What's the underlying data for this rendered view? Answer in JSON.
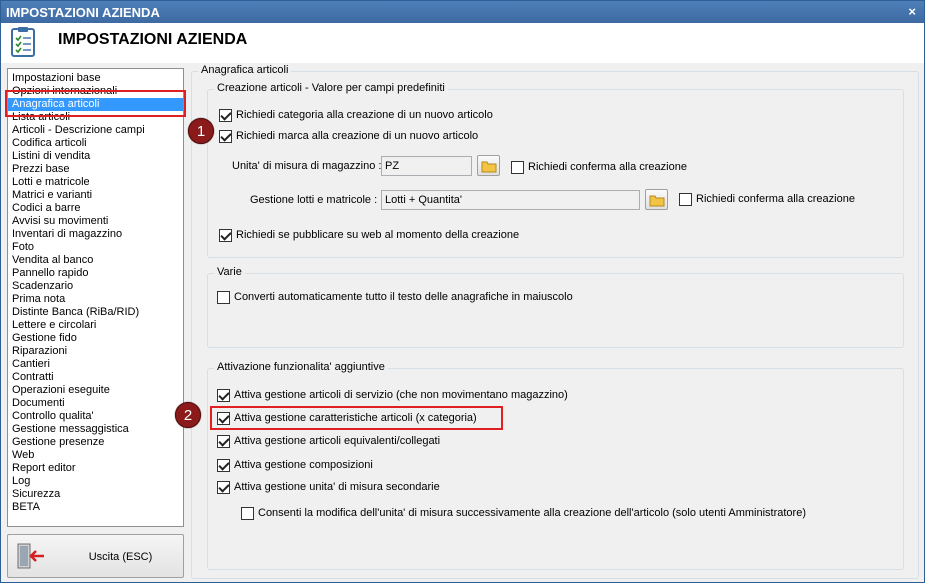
{
  "window": {
    "title": "IMPOSTAZIONI AZIENDA",
    "close_glyph": "×"
  },
  "header": {
    "title": "IMPOSTAZIONI AZIENDA",
    "icon": "checklist-icon"
  },
  "nav": {
    "items": [
      "Impostazioni base",
      "Opzioni internazionali",
      "Anagrafica articoli",
      "Lista articoli",
      "Articoli - Descrizione campi",
      "Codifica articoli",
      "Listini di vendita",
      "Prezzi base",
      "Lotti e matricole",
      "Matrici e varianti",
      "Codici a barre",
      "Avvisi su movimenti",
      "Inventari di magazzino",
      "Foto",
      "Vendita al banco",
      "Pannello rapido",
      "Scadenzario",
      "Prima nota",
      "Distinte Banca (RiBa/RID)",
      "Lettere e circolari",
      "Gestione fido",
      "Riparazioni",
      "Cantieri",
      "Contratti",
      "Operazioni eseguite",
      "Documenti",
      "Controllo qualita'",
      "Gestione messaggistica",
      "Gestione presenze",
      "Web",
      "Report editor",
      "Log",
      "Sicurezza",
      "BETA"
    ],
    "selected_index": 2
  },
  "exit_button": {
    "label": "Uscita (ESC)",
    "icon": "exit-door-icon"
  },
  "main": {
    "title": "Anagrafica articoli",
    "creation": {
      "title": "Creazione articoli - Valore per campi predefiniti",
      "require_category": {
        "label": "Richiedi categoria alla creazione di un nuovo articolo",
        "checked": true
      },
      "require_brand": {
        "label": "Richiedi marca alla creazione di un nuovo articolo",
        "checked": true
      },
      "unit_label": "Unita' di misura di magazzino :",
      "unit_value": "PZ",
      "unit_confirm": {
        "label": "Richiedi conferma alla creazione",
        "checked": false
      },
      "lots_label": "Gestione lotti e matricole :",
      "lots_value": "Lotti + Quantita'",
      "lots_confirm": {
        "label": "Richiedi conferma alla creazione",
        "checked": false
      },
      "publish_web": {
        "label": "Richiedi se pubblicare su web al momento della creazione",
        "checked": true
      }
    },
    "misc": {
      "title": "Varie",
      "uppercase": {
        "label": "Converti automaticamente tutto il testo delle anagrafiche in maiuscolo",
        "checked": false
      }
    },
    "features": {
      "title": "Attivazione funzionalita' aggiuntive",
      "service_items": {
        "label": "Attiva gestione articoli di servizio (che non movimentano magazzino)",
        "checked": true
      },
      "characteristics": {
        "label": "Attiva gestione caratteristiche articoli (x categoria)",
        "checked": true
      },
      "equivalents": {
        "label": "Attiva gestione articoli equivalenti/collegati",
        "checked": true
      },
      "compositions": {
        "label": "Attiva gestione composizioni",
        "checked": true
      },
      "secondary_units": {
        "label": "Attiva gestione unita' di misura secondarie",
        "checked": true
      },
      "allow_unit_change": {
        "label": "Consenti la modifica dell'unita' di misura successivamente alla creazione dell'articolo (solo utenti Amministratore)",
        "checked": false
      }
    }
  },
  "annotations": {
    "badge_1": "1",
    "badge_2": "2"
  },
  "colors": {
    "titlebar": "#3d6aa3",
    "selection": "#3399ff",
    "highlight": "#e02020",
    "badge": "#8b1a1a"
  }
}
